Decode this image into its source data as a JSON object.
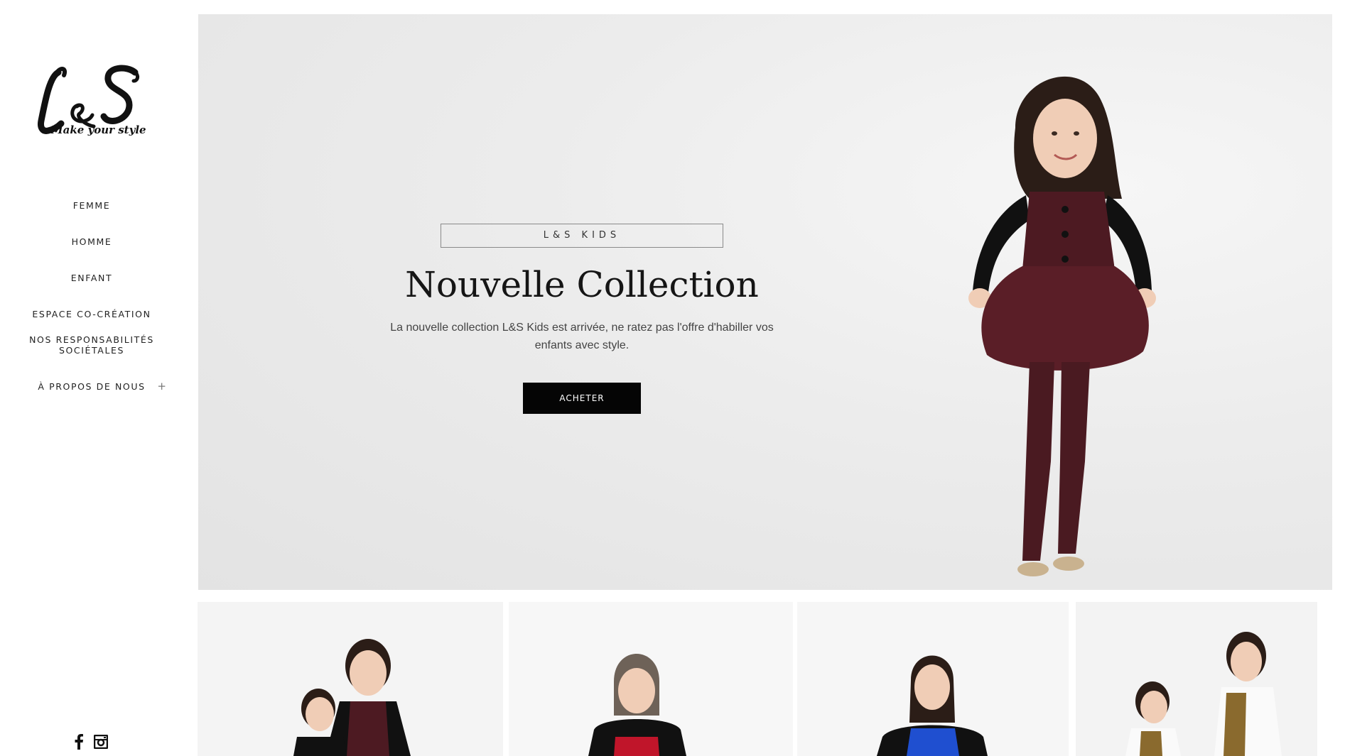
{
  "brand": {
    "logo_text": "L&S",
    "tagline": "Make your style"
  },
  "nav": {
    "items": [
      {
        "label": "FEMME"
      },
      {
        "label": "HOMME"
      },
      {
        "label": "ENFANT"
      },
      {
        "label": "ESPACE CO-CRÉATION"
      },
      {
        "label": "NOS RESPONSABILITÉS SOCIÉTALES"
      },
      {
        "label": "À PROPOS DE NOUS",
        "expand": "+"
      }
    ]
  },
  "social": {
    "icons": [
      "facebook-icon",
      "instagram-icon"
    ]
  },
  "hero": {
    "tag": "L&S KIDS",
    "title": "Nouvelle Collection",
    "text": "La nouvelle collection L&S Kids est arrivée, ne ratez pas l'offre d'habiller vos enfants avec style.",
    "button_label": "ACHETER"
  },
  "colors": {
    "accent": "#050505",
    "burgundy": "#5a1a22",
    "red": "#c0152a",
    "blue": "#1f4fd0",
    "background": "#ececec"
  }
}
